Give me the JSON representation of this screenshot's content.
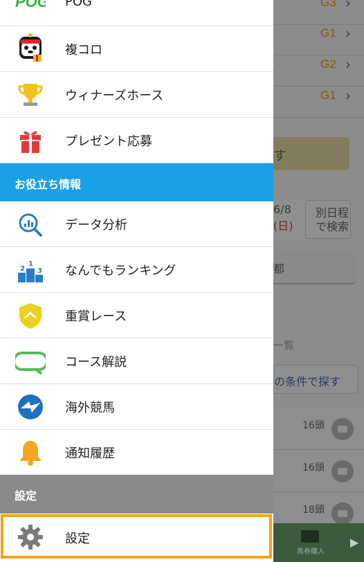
{
  "drawer": {
    "items_top": [
      {
        "label": "POG",
        "icon": "pog-logo"
      },
      {
        "label": "複コロ",
        "icon": "mascot-icon"
      },
      {
        "label": "ウィナーズホース",
        "icon": "trophy-icon"
      },
      {
        "label": "プレゼント応募",
        "icon": "gift-icon"
      }
    ],
    "section_info": "お役立ち情報",
    "items_info": [
      {
        "label": "データ分析",
        "icon": "data-search-icon"
      },
      {
        "label": "なんでもランキング",
        "icon": "ranking-podium-icon"
      },
      {
        "label": "重賞レース",
        "icon": "shield-icon"
      },
      {
        "label": "コース解説",
        "icon": "course-icon"
      },
      {
        "label": "海外競馬",
        "icon": "globe-icon"
      },
      {
        "label": "通知履歴",
        "icon": "bell-icon"
      }
    ],
    "section_settings": "設定",
    "settings_item": {
      "label": "設定",
      "icon": "gear-icon"
    },
    "pog_logo_text": "POG"
  },
  "background": {
    "grades": [
      {
        "grade": "G3"
      },
      {
        "grade": "G1"
      },
      {
        "grade": "G2"
      },
      {
        "grade": "G1"
      }
    ],
    "yellow_button_text": "す",
    "date_top": "6/8",
    "date_bottom": "(日)",
    "other_date_top": "別日程",
    "other_date_bottom": "で検索",
    "section_tail": "都",
    "list_label": "一覧",
    "search_condition": "の条件で探す",
    "races": [
      {
        "heads": "16頭"
      },
      {
        "heads": "16頭"
      },
      {
        "heads": "18頭"
      }
    ],
    "buy_label": "馬券購入"
  },
  "colors": {
    "accent_blue": "#1aa0e6",
    "highlight_orange": "#f7a21b",
    "section_gray": "#8a8a8a"
  }
}
